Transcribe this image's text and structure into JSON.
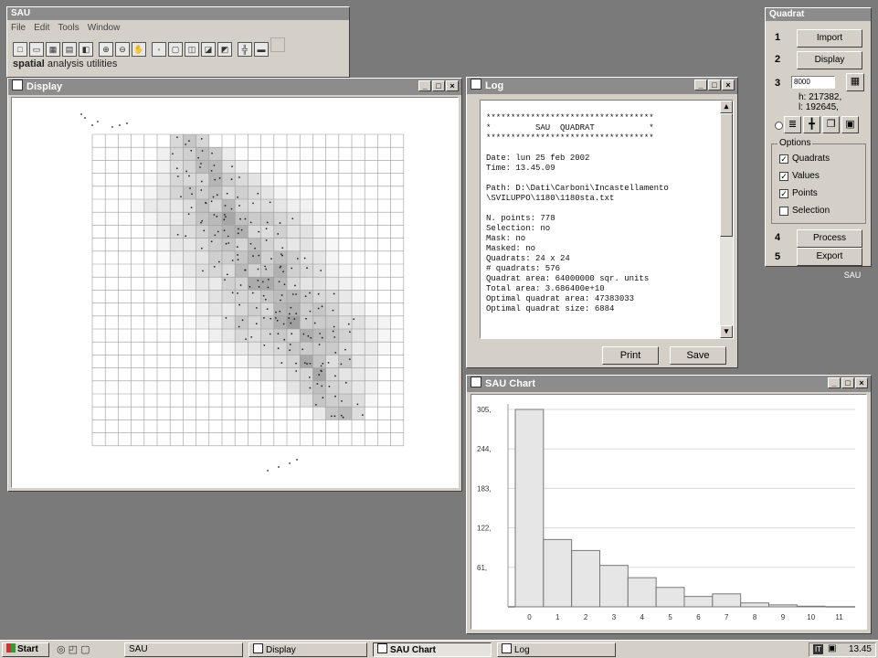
{
  "sau_window": {
    "title": "SAU",
    "menu": [
      "File",
      "Edit",
      "Tools",
      "Window"
    ],
    "subtitle_bold": "spatial",
    "subtitle_rest": " analysis utilities"
  },
  "display_window": {
    "title": "Display"
  },
  "log_window": {
    "title": "Log",
    "lines": [
      "**********************************",
      "*         SAU  QUADRAT           *",
      "**********************************",
      "",
      "Date: lun 25 feb 2002",
      "Time: 13.45.09",
      "",
      "Path: D:\\Dati\\Carboni\\Incastellamento",
      "\\SVILUPPO\\1180\\1180sta.txt",
      "",
      "N. points: 778",
      "Selection: no",
      "Mask: no",
      "Masked: no",
      "Quadrats: 24 x 24",
      "# quadrats: 576",
      "Quadrat area: 64000000 sqr. units",
      "Total area: 3.686400e+10",
      "Optimal quadrat area: 47383033",
      "Optimal quadrat size: 6884"
    ],
    "print_label": "Print",
    "save_label": "Save"
  },
  "chart_window": {
    "title": "SAU Chart"
  },
  "chart_data": {
    "type": "bar",
    "title": "",
    "xlabel": "",
    "ylabel": "",
    "categories": [
      "0",
      "1",
      "2",
      "3",
      "4",
      "5",
      "6",
      "7",
      "8",
      "9",
      "10",
      "11"
    ],
    "values": [
      305,
      104,
      87,
      64,
      45,
      30,
      16,
      20,
      6,
      3,
      1,
      0
    ],
    "ylim": [
      0,
      305
    ],
    "yticks": [
      "305,",
      "244,",
      "183,",
      "122,",
      "61,"
    ],
    "ytick_values": [
      305,
      244,
      183,
      122,
      61
    ],
    "grid": true
  },
  "quadrat_panel": {
    "title": "Quadrat",
    "steps": [
      {
        "num": "1",
        "label": "Import"
      },
      {
        "num": "2",
        "label": "Display"
      },
      {
        "num": "3",
        "input_value": "8000",
        "h_text": "h: 217382,",
        "l_text": "l: 192645,"
      },
      {
        "num": "4",
        "label": "Process"
      },
      {
        "num": "5",
        "label": "Export"
      }
    ],
    "options_title": "Options",
    "options": [
      {
        "label": "Quadrats",
        "checked": true
      },
      {
        "label": "Values",
        "checked": true
      },
      {
        "label": "Points",
        "checked": true
      },
      {
        "label": "Selection",
        "checked": false
      }
    ]
  },
  "desktop_icon_label": "SAU",
  "taskbar": {
    "start_label": "Start",
    "tasks": [
      "SAU",
      "Display",
      "SAU Chart",
      "Log"
    ],
    "clock": "13.45"
  }
}
